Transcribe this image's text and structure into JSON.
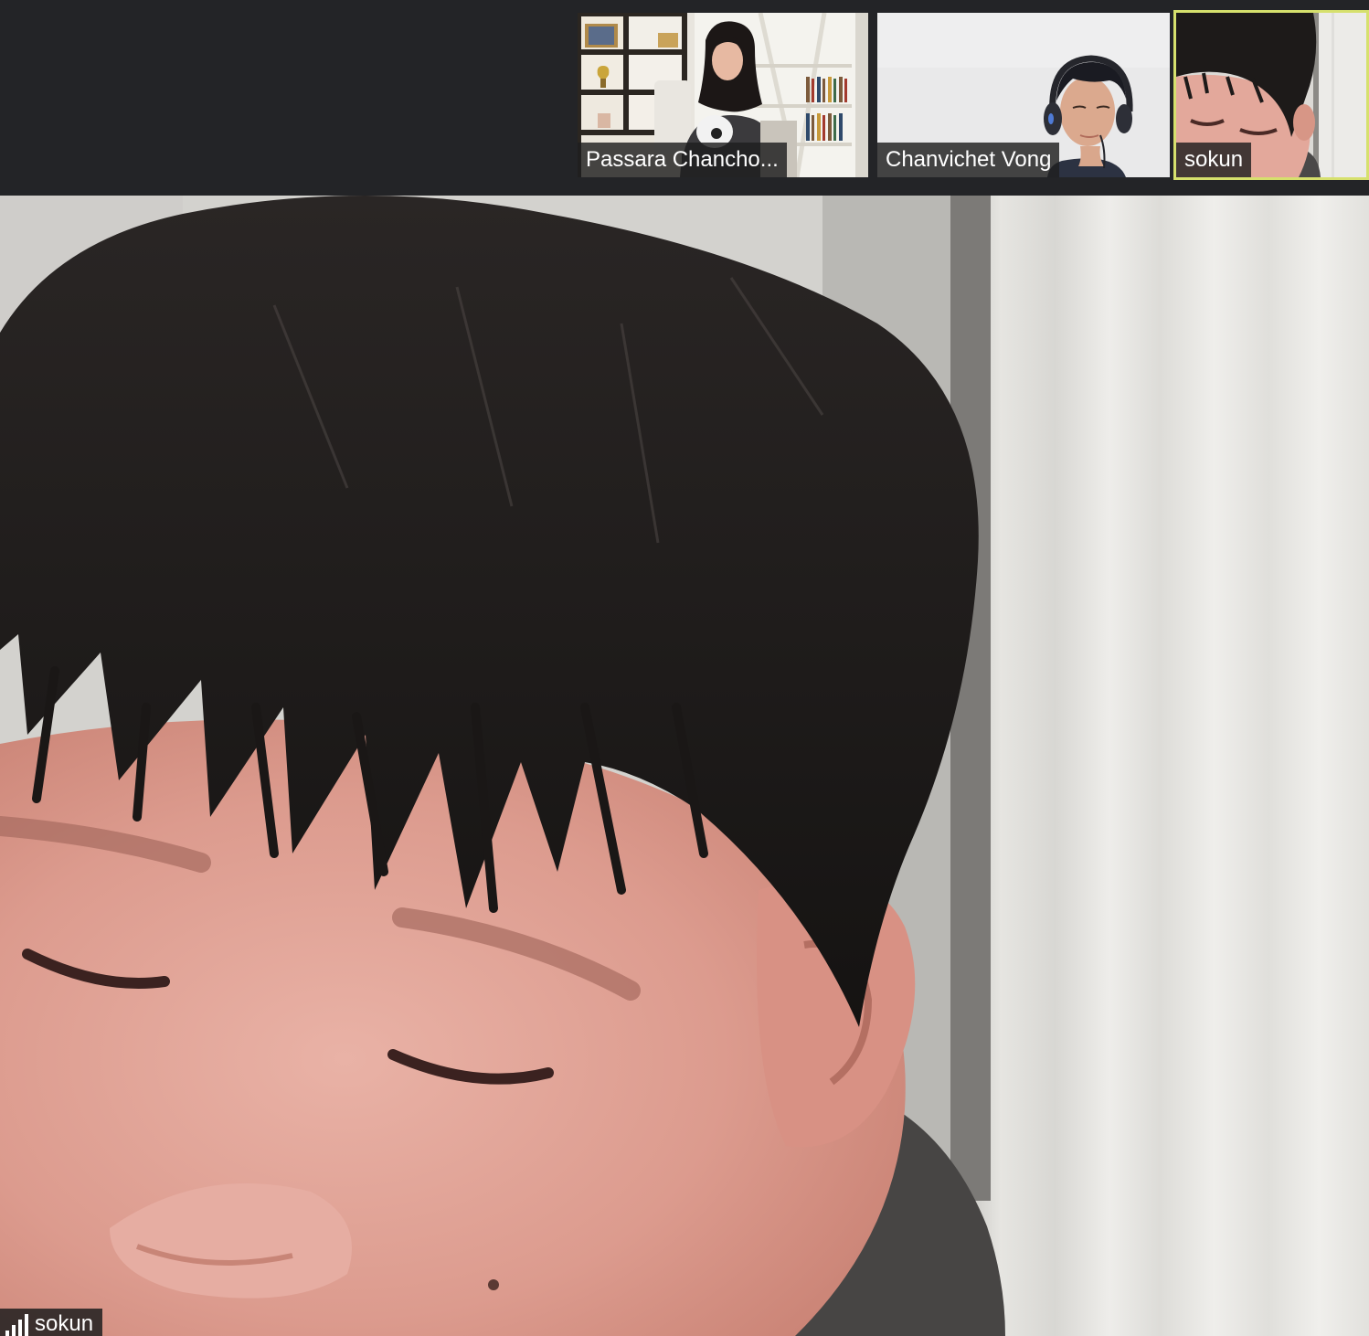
{
  "participants": [
    {
      "name": "Passara Chancho..."
    },
    {
      "name": "Chanvichet Vong"
    },
    {
      "name": "sokun",
      "active_speaker": true
    }
  ],
  "main_view": {
    "speaker_name": "sokun",
    "signal_icon": "signal-strength-icon"
  },
  "colors": {
    "strip_background": "#232427",
    "active_border": "#d6e06d",
    "name_tag_background": "#1e1e1e"
  }
}
